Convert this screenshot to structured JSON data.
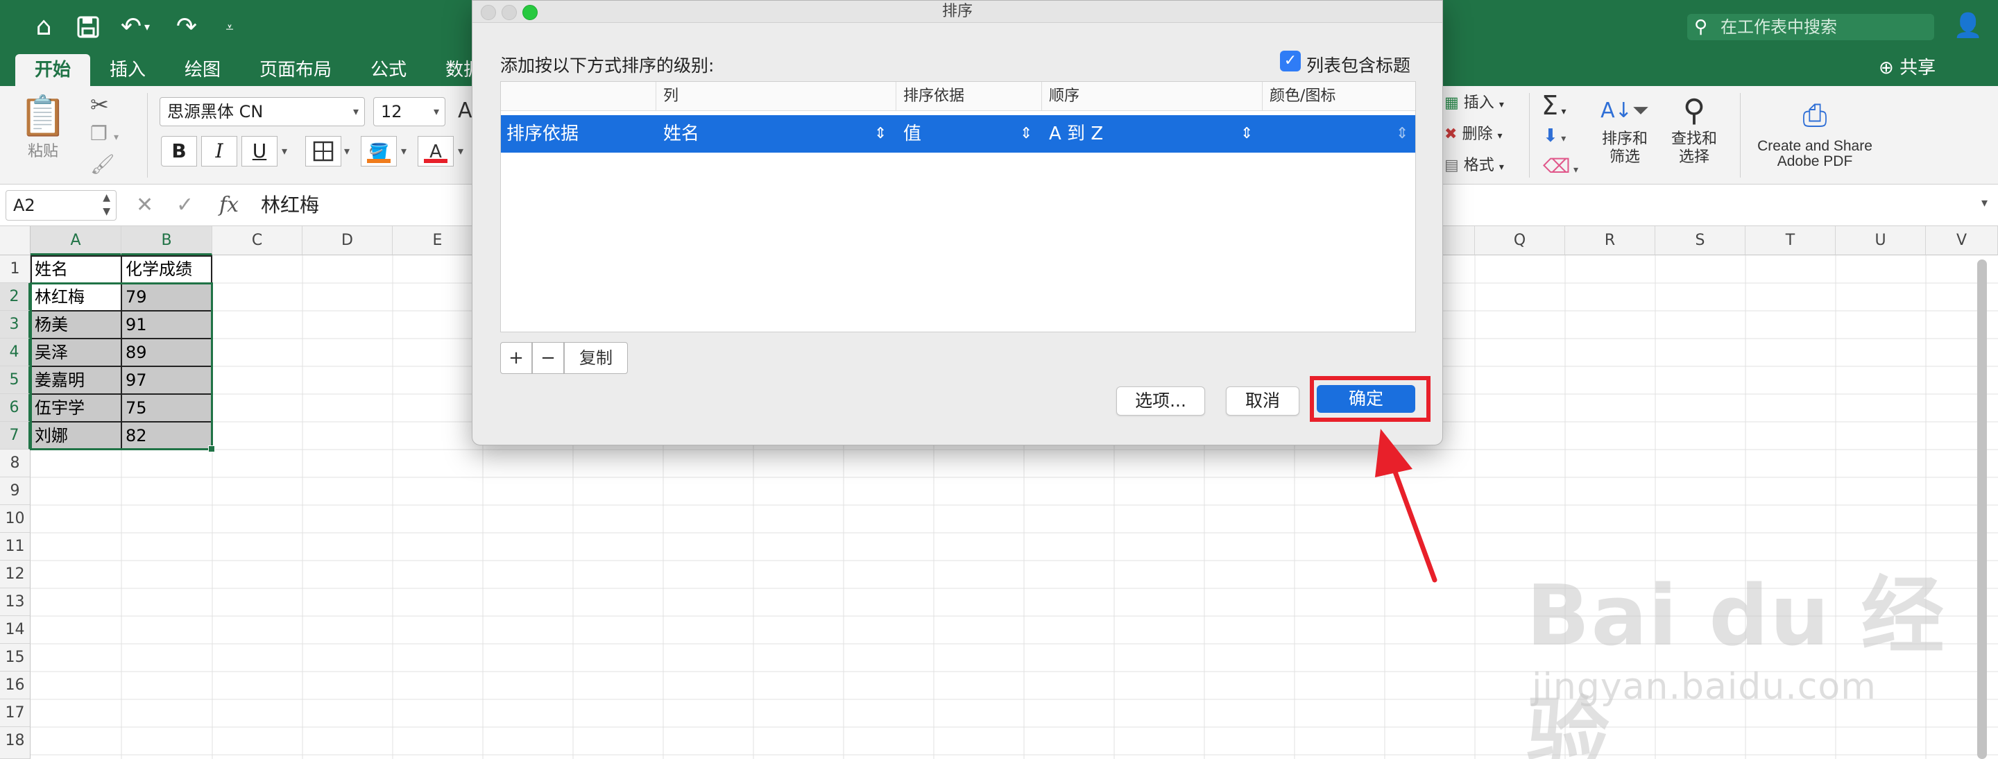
{
  "toolbar": {
    "tabs": [
      {
        "label": "开始",
        "active": true
      },
      {
        "label": "插入",
        "active": false
      },
      {
        "label": "绘图",
        "active": false
      },
      {
        "label": "页面布局",
        "active": false
      },
      {
        "label": "公式",
        "active": false
      },
      {
        "label": "数据",
        "active": false
      }
    ],
    "search_placeholder": "在工作表中搜索",
    "share_label": "共享"
  },
  "ribbon": {
    "paste_label": "粘贴",
    "font_name": "思源黑体 CN",
    "font_size": "12",
    "bold": "B",
    "italic": "I",
    "underline": "U",
    "insert_label": "插入",
    "delete_label": "删除",
    "format_label": "格式",
    "sort_filter_label": "排序和\n筛选",
    "find_select_label": "查找和\n选择",
    "adobe_label": "Create and Share\nAdobe PDF"
  },
  "formula_bar": {
    "name_box": "A2",
    "content": "林红梅"
  },
  "sheet": {
    "columns": [
      "A",
      "B",
      "C",
      "D",
      "E",
      "Q",
      "R",
      "S",
      "T",
      "U",
      "V"
    ],
    "rows": [
      "1",
      "2",
      "3",
      "4",
      "5",
      "6",
      "7",
      "8",
      "9",
      "10",
      "11",
      "12",
      "13",
      "14",
      "15",
      "16",
      "17",
      "18"
    ],
    "cells": [
      [
        "姓名",
        "化学成绩"
      ],
      [
        "林红梅",
        "79"
      ],
      [
        "杨美",
        "91"
      ],
      [
        "吴泽",
        "89"
      ],
      [
        "姜嘉明",
        "97"
      ],
      [
        "伍宇学",
        "75"
      ],
      [
        "刘娜",
        "82"
      ]
    ]
  },
  "dialog": {
    "title": "排序",
    "heading": "添加按以下方式排序的级别:",
    "header_checkbox_label": "列表包含标题",
    "header_checkbox_checked": true,
    "columns": [
      "列",
      "排序依据",
      "顺序",
      "颜色/图标"
    ],
    "row": {
      "level_label": "排序依据",
      "column": "姓名",
      "sort_on": "值",
      "order": "A 到 Z",
      "color": ""
    },
    "add_button": "+",
    "remove_button": "−",
    "copy_button": "复制",
    "options_button": "选项...",
    "cancel_button": "取消",
    "ok_button": "确定"
  },
  "watermark": {
    "logo_text": "Bai du 经验",
    "url": "jingyan.baidu.com"
  },
  "colors": {
    "excel_green": "#207346",
    "accent_blue": "#1a6fde",
    "highlight_red": "#e8202a"
  }
}
